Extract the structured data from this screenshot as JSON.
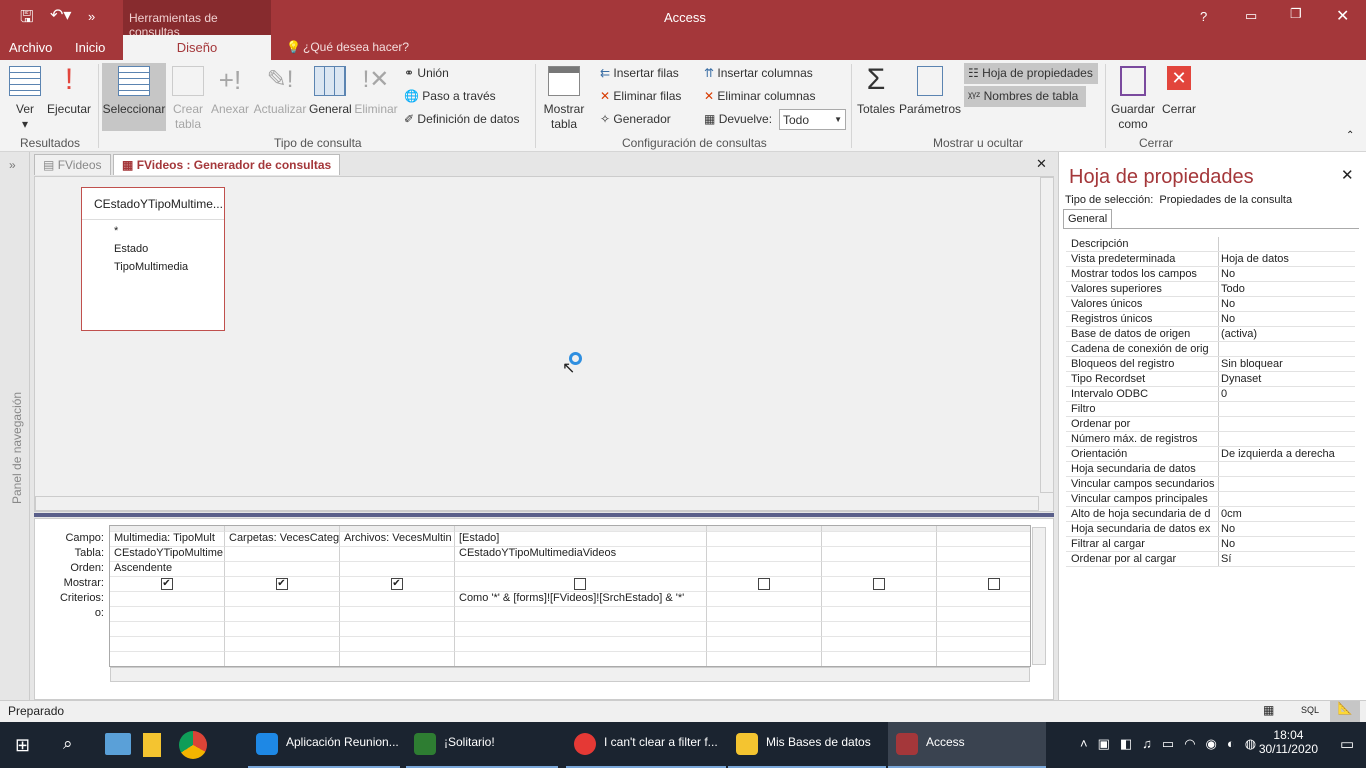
{
  "titlebar": {
    "app": "Access",
    "context_tab": "Herramientas de consultas",
    "help": "?",
    "qat_more": "»"
  },
  "menu_tabs": [
    "Archivo",
    "Inicio",
    "Diseño"
  ],
  "tell_me": "¿Qué desea hacer?",
  "ribbon": {
    "resultados": {
      "label": "Resultados",
      "ver": "Ver",
      "ejecutar": "Ejecutar"
    },
    "tipo": {
      "label": "Tipo de consulta",
      "seleccionar": "Seleccionar",
      "crear": "Crear tabla",
      "anexar": "Anexar",
      "actualizar": "Actualizar",
      "general": "General",
      "eliminar": "Eliminar",
      "union": "Unión",
      "paso": "Paso a través",
      "definicion": "Definición de datos"
    },
    "config": {
      "label": "Configuración de consultas",
      "mostrar": "Mostrar tabla",
      "ins_filas": "Insertar filas",
      "elim_filas": "Eliminar filas",
      "generador": "Generador",
      "ins_cols": "Insertar columnas",
      "elim_cols": "Eliminar columnas",
      "devuelve": "Devuelve:",
      "devuelve_val": "Todo"
    },
    "mostrar": {
      "label": "Mostrar u ocultar",
      "totales": "Totales",
      "parametros": "Parámetros",
      "hoja": "Hoja de propiedades",
      "nombres": "Nombres de tabla"
    },
    "cerrar": {
      "label": "Cerrar",
      "guardar": "Guardar como",
      "cerrar": "Cerrar"
    }
  },
  "nav_pane": "Panel de navegación",
  "doc_tabs": [
    "FVideos",
    "FVideos : Generador de consultas"
  ],
  "field_list": {
    "title": "CEstadoYTipoMultime...",
    "fields": [
      "*",
      "Estado",
      "TipoMultimedia"
    ]
  },
  "grid": {
    "row_labels": [
      "Campo:",
      "Tabla:",
      "Orden:",
      "Mostrar:",
      "Criterios:",
      "o:"
    ],
    "columns": [
      {
        "campo": "Multimedia: TipoMult",
        "tabla": "CEstadoYTipoMultime",
        "orden": "Ascendente",
        "mostrar": true,
        "criterios": ""
      },
      {
        "campo": "Carpetas: VecesCateg",
        "tabla": "",
        "orden": "",
        "mostrar": true,
        "criterios": ""
      },
      {
        "campo": "Archivos: VecesMultin",
        "tabla": "",
        "orden": "",
        "mostrar": true,
        "criterios": ""
      },
      {
        "campo": "[Estado]",
        "tabla": "CEstadoYTipoMultimediaVideos",
        "orden": "",
        "mostrar": false,
        "criterios": "Como '*' & [forms]![FVideos]![SrchEstado] & '*'"
      },
      {
        "campo": "",
        "tabla": "",
        "orden": "",
        "mostrar": false,
        "criterios": ""
      },
      {
        "campo": "",
        "tabla": "",
        "orden": "",
        "mostrar": false,
        "criterios": ""
      },
      {
        "campo": "",
        "tabla": "",
        "orden": "",
        "mostrar": false,
        "criterios": ""
      }
    ]
  },
  "props": {
    "title": "Hoja de propiedades",
    "sel_label": "Tipo de selección:",
    "sel_value": "Propiedades de la consulta",
    "tab": "General",
    "rows": [
      [
        "Descripción",
        ""
      ],
      [
        "Vista predeterminada",
        "Hoja de datos"
      ],
      [
        "Mostrar todos los campos",
        "No"
      ],
      [
        "Valores superiores",
        "Todo"
      ],
      [
        "Valores únicos",
        "No"
      ],
      [
        "Registros únicos",
        "No"
      ],
      [
        "Base de datos de origen",
        "(activa)"
      ],
      [
        "Cadena de conexión de orig",
        ""
      ],
      [
        "Bloqueos del registro",
        "Sin bloquear"
      ],
      [
        "Tipo Recordset",
        "Dynaset"
      ],
      [
        "Intervalo ODBC",
        "0"
      ],
      [
        "Filtro",
        ""
      ],
      [
        "Ordenar por",
        ""
      ],
      [
        "Número máx. de registros",
        ""
      ],
      [
        "Orientación",
        "De izquierda a derecha"
      ],
      [
        "Hoja secundaria de datos",
        ""
      ],
      [
        "Vincular campos secundarios",
        ""
      ],
      [
        "Vincular campos principales",
        ""
      ],
      [
        "Alto de hoja secundaria de d",
        "0cm"
      ],
      [
        "Hoja secundaria de datos ex",
        "No"
      ],
      [
        "Filtrar al cargar",
        "No"
      ],
      [
        "Ordenar por al cargar",
        "Sí"
      ]
    ]
  },
  "status": {
    "text": "Preparado",
    "sql": "SQL"
  },
  "taskbar": {
    "items": [
      {
        "label": "Aplicación Reunion...",
        "color": "#1e88e5"
      },
      {
        "label": "¡Solitario!",
        "color": "#2e7d32"
      },
      {
        "label": "I can't clear a filter f...",
        "color": "#e53935"
      },
      {
        "label": "Mis Bases de datos",
        "color": "#f4c430"
      },
      {
        "label": "Access",
        "color": "#a4373a"
      }
    ],
    "time": "18:04",
    "date": "30/11/2020"
  }
}
